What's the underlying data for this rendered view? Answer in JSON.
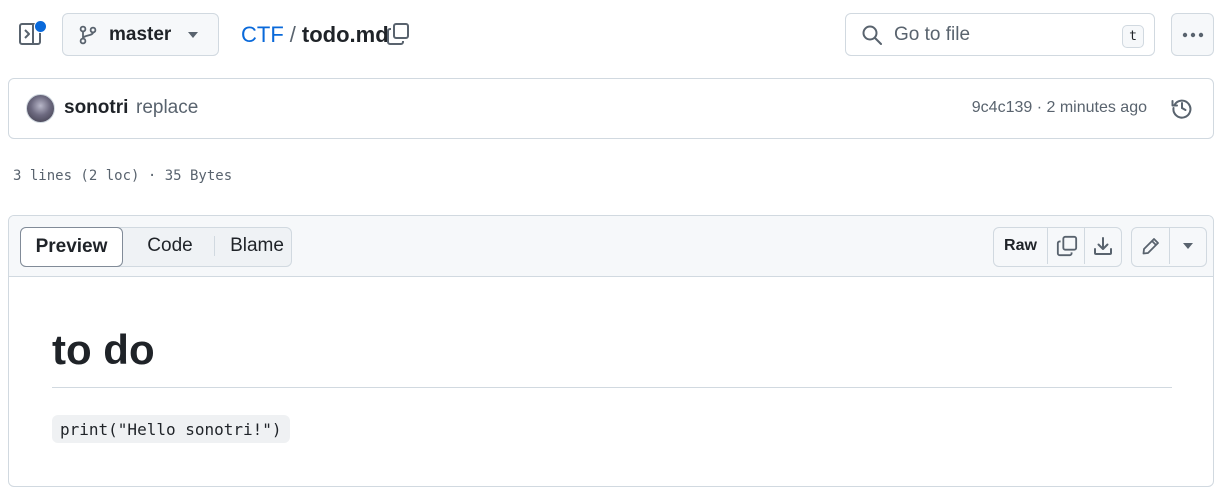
{
  "header": {
    "branch": "master",
    "repo": "CTF",
    "separator": "/",
    "file": "todo.md",
    "search_placeholder": "Go to file",
    "search_shortcut": "t"
  },
  "commit": {
    "author": "sonotri",
    "message": "replace",
    "sha_time": "9c4c139 · 2 minutes ago"
  },
  "file_meta": "3 lines (2 loc) · 35 Bytes",
  "tabs": {
    "preview": "Preview",
    "code": "Code",
    "blame": "Blame",
    "active": "Preview"
  },
  "actions": {
    "raw": "Raw"
  },
  "content": {
    "heading": "to do",
    "code": "print(\"Hello sonotri!\")"
  },
  "colors": {
    "link": "#0969da",
    "border": "#d1d9e0",
    "muted": "#59636e",
    "notification_dot": "#0969da"
  },
  "icons": [
    "sidebar-expand-icon",
    "git-branch-icon",
    "caret-down-icon",
    "copy-icon",
    "search-icon",
    "kebab-horizontal-icon",
    "history-icon",
    "download-icon",
    "pencil-icon"
  ]
}
